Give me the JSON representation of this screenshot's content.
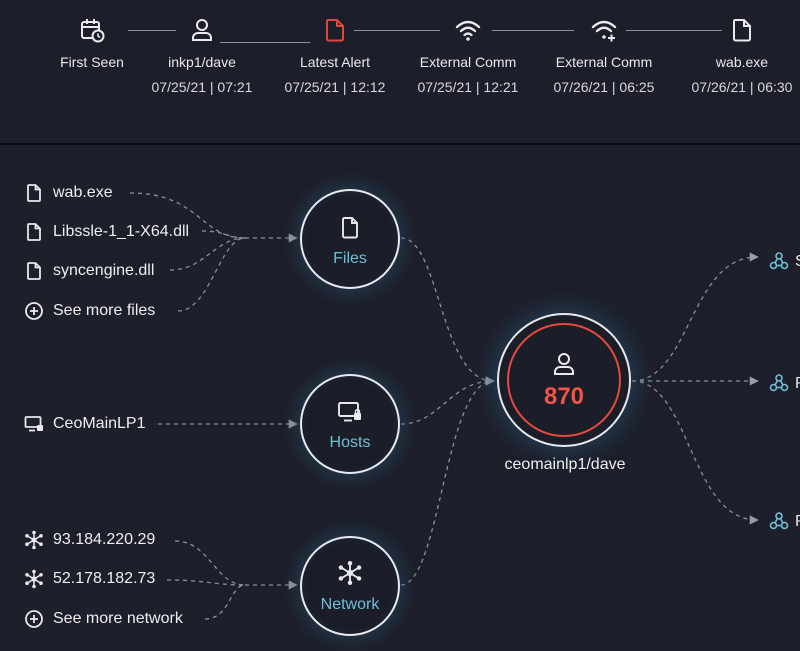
{
  "timeline": {
    "events": [
      {
        "label": "First Seen",
        "time": "",
        "icon": "calendar-clock-icon"
      },
      {
        "label": "inkp1/dave",
        "time": "07/25/21 | 07:21",
        "icon": "user-icon"
      },
      {
        "label": "Latest Alert",
        "time": "07/25/21 | 12:12",
        "icon": "file-alert-icon"
      },
      {
        "label": "External Comm",
        "time": "07/25/21 | 12:21",
        "icon": "wifi-icon"
      },
      {
        "label": "External Comm",
        "time": "07/26/21 | 06:25",
        "icon": "wifi-plus-icon"
      },
      {
        "label": "wab.exe",
        "time": "07/26/21 | 06:30",
        "icon": "file-icon"
      }
    ],
    "alert_color": "#e0473c"
  },
  "graph": {
    "files": {
      "items": [
        "wab.exe",
        "Libssle-1_1-X64.dll",
        "syncengine.dll"
      ],
      "more": "See more files",
      "hub_label": "Files"
    },
    "hosts": {
      "items": [
        "CeoMainLP1"
      ],
      "hub_label": "Hosts"
    },
    "network": {
      "items": [
        "93.184.220.29",
        "52.178.182.73"
      ],
      "more": "See more network",
      "hub_label": "Network"
    },
    "center": {
      "score": "870",
      "user": "ceomainlp1/dave",
      "score_color": "#ef5548"
    },
    "right": [
      {
        "label": "S",
        "icon": "cluster-icon"
      },
      {
        "label": "R",
        "icon": "cluster-icon"
      },
      {
        "label": "R",
        "icon": "cluster-icon"
      }
    ],
    "accent_color": "#6ec0d8"
  }
}
